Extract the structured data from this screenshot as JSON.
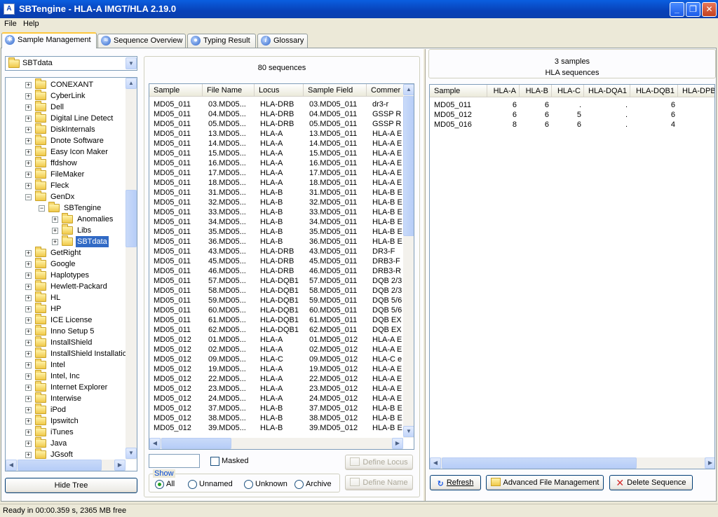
{
  "window": {
    "title": "SBTengine - HLA-A IMGT/HLA 2.19.0",
    "app_icon": "A"
  },
  "menu": [
    {
      "label": "File"
    },
    {
      "label": "Help"
    }
  ],
  "tabs": [
    {
      "label": "Sample Management",
      "icon": "gear-icon",
      "active": true
    },
    {
      "label": "Sequence Overview",
      "icon": "chart-icon",
      "active": false
    },
    {
      "label": "Typing Result",
      "icon": "result-icon",
      "active": false
    },
    {
      "label": "Glossary",
      "icon": "info-icon",
      "active": false
    }
  ],
  "sample_management": {
    "folder_dropdown": {
      "value": "SBTdata"
    },
    "tree": [
      {
        "label": "CONEXANT",
        "level": 1
      },
      {
        "label": "CyberLink",
        "level": 1
      },
      {
        "label": "Dell",
        "level": 1
      },
      {
        "label": "Digital Line Detect",
        "level": 1
      },
      {
        "label": "DiskInternals",
        "level": 1
      },
      {
        "label": "Dnote Software",
        "level": 1
      },
      {
        "label": "Easy Icon Maker",
        "level": 1
      },
      {
        "label": "ffdshow",
        "level": 1
      },
      {
        "label": "FileMaker",
        "level": 1
      },
      {
        "label": "Fleck",
        "level": 1
      },
      {
        "label": "GenDx",
        "level": 1,
        "expanded": true
      },
      {
        "label": "SBTengine",
        "level": 2,
        "expanded": true
      },
      {
        "label": "Anomalies",
        "level": 3
      },
      {
        "label": "Libs",
        "level": 3
      },
      {
        "label": "SBTdata",
        "level": 3,
        "selected": true
      },
      {
        "label": "GetRight",
        "level": 1
      },
      {
        "label": "Google",
        "level": 1
      },
      {
        "label": "Haplotypes",
        "level": 1
      },
      {
        "label": "Hewlett-Packard",
        "level": 1
      },
      {
        "label": "HL",
        "level": 1
      },
      {
        "label": "HP",
        "level": 1
      },
      {
        "label": "ICE License",
        "level": 1
      },
      {
        "label": "Inno Setup 5",
        "level": 1
      },
      {
        "label": "InstallShield",
        "level": 1
      },
      {
        "label": "InstallShield Installatio",
        "level": 1
      },
      {
        "label": "Intel",
        "level": 1
      },
      {
        "label": "Intel, Inc",
        "level": 1
      },
      {
        "label": "Internet Explorer",
        "level": 1
      },
      {
        "label": "Interwise",
        "level": 1
      },
      {
        "label": "iPod",
        "level": 1
      },
      {
        "label": "Ipswitch",
        "level": 1
      },
      {
        "label": "iTunes",
        "level": 1
      },
      {
        "label": "Java",
        "level": 1
      },
      {
        "label": "JGsoft",
        "level": 1
      }
    ],
    "hide_tree_label": "Hide Tree",
    "sequences": {
      "count_label": "80 sequences",
      "columns": [
        "Sample",
        "File Name",
        "Locus",
        "Sample Field",
        "Commer"
      ],
      "rows": [
        [
          "MD05_011",
          "03.MD05...",
          "HLA-DRB",
          "03.MD05_011",
          "dr3-r"
        ],
        [
          "MD05_011",
          "04.MD05...",
          "HLA-DRB",
          "04.MD05_011",
          "GSSP R"
        ],
        [
          "MD05_011",
          "05.MD05...",
          "HLA-DRB",
          "05.MD05_011",
          "GSSP R"
        ],
        [
          "MD05_011",
          "13.MD05...",
          "HLA-A",
          "13.MD05_011",
          "HLA-A E"
        ],
        [
          "MD05_011",
          "14.MD05...",
          "HLA-A",
          "14.MD05_011",
          "HLA-A E"
        ],
        [
          "MD05_011",
          "15.MD05...",
          "HLA-A",
          "15.MD05_011",
          "HLA-A E"
        ],
        [
          "MD05_011",
          "16.MD05...",
          "HLA-A",
          "16.MD05_011",
          "HLA-A E"
        ],
        [
          "MD05_011",
          "17.MD05...",
          "HLA-A",
          "17.MD05_011",
          "HLA-A E"
        ],
        [
          "MD05_011",
          "18.MD05...",
          "HLA-A",
          "18.MD05_011",
          "HLA-A E"
        ],
        [
          "MD05_011",
          "31.MD05...",
          "HLA-B",
          "31.MD05_011",
          "HLA-B E"
        ],
        [
          "MD05_011",
          "32.MD05...",
          "HLA-B",
          "32.MD05_011",
          "HLA-B E"
        ],
        [
          "MD05_011",
          "33.MD05...",
          "HLA-B",
          "33.MD05_011",
          "HLA-B E"
        ],
        [
          "MD05_011",
          "34.MD05...",
          "HLA-B",
          "34.MD05_011",
          "HLA-B E"
        ],
        [
          "MD05_011",
          "35.MD05...",
          "HLA-B",
          "35.MD05_011",
          "HLA-B E"
        ],
        [
          "MD05_011",
          "36.MD05...",
          "HLA-B",
          "36.MD05_011",
          "HLA-B E"
        ],
        [
          "MD05_011",
          "43.MD05...",
          "HLA-DRB",
          "43.MD05_011",
          "DR3-F"
        ],
        [
          "MD05_011",
          "45.MD05...",
          "HLA-DRB",
          "45.MD05_011",
          "DRB3-F"
        ],
        [
          "MD05_011",
          "46.MD05...",
          "HLA-DRB",
          "46.MD05_011",
          "DRB3-R"
        ],
        [
          "MD05_011",
          "57.MD05...",
          "HLA-DQB1",
          "57.MD05_011",
          "DQB 2/3"
        ],
        [
          "MD05_011",
          "58.MD05...",
          "HLA-DQB1",
          "58.MD05_011",
          "DQB 2/3"
        ],
        [
          "MD05_011",
          "59.MD05...",
          "HLA-DQB1",
          "59.MD05_011",
          "DQB 5/6"
        ],
        [
          "MD05_011",
          "60.MD05...",
          "HLA-DQB1",
          "60.MD05_011",
          "DQB 5/6"
        ],
        [
          "MD05_011",
          "61.MD05...",
          "HLA-DQB1",
          "61.MD05_011",
          "DQB EX"
        ],
        [
          "MD05_011",
          "62.MD05...",
          "HLA-DQB1",
          "62.MD05_011",
          "DQB EX"
        ],
        [
          "MD05_012",
          "01.MD05...",
          "HLA-A",
          "01.MD05_012",
          "HLA-A E"
        ],
        [
          "MD05_012",
          "02.MD05...",
          "HLA-A",
          "02.MD05_012",
          "HLA-A E"
        ],
        [
          "MD05_012",
          "09.MD05...",
          "HLA-C",
          "09.MD05_012",
          "HLA-C e"
        ],
        [
          "MD05_012",
          "19.MD05...",
          "HLA-A",
          "19.MD05_012",
          "HLA-A E"
        ],
        [
          "MD05_012",
          "22.MD05...",
          "HLA-A",
          "22.MD05_012",
          "HLA-A E"
        ],
        [
          "MD05_012",
          "23.MD05...",
          "HLA-A",
          "23.MD05_012",
          "HLA-A E"
        ],
        [
          "MD05_012",
          "24.MD05...",
          "HLA-A",
          "24.MD05_012",
          "HLA-A E"
        ],
        [
          "MD05_012",
          "37.MD05...",
          "HLA-B",
          "37.MD05_012",
          "HLA-B E"
        ],
        [
          "MD05_012",
          "38.MD05...",
          "HLA-B",
          "38.MD05_012",
          "HLA-B E"
        ],
        [
          "MD05_012",
          "39.MD05...",
          "HLA-B",
          "39.MD05_012",
          "HLA-B E"
        ]
      ],
      "search_value": "",
      "masked_label": "Masked",
      "define_locus_label": "Define Locus",
      "define_name_label": "Define Name",
      "show": {
        "legend": "Show",
        "options": [
          {
            "label": "All",
            "selected": true
          },
          {
            "label": "Unnamed",
            "selected": false
          },
          {
            "label": "Unknown",
            "selected": false
          },
          {
            "label": "Archive",
            "selected": false
          }
        ]
      }
    },
    "samples": {
      "count_label": "3 samples",
      "subtitle": "HLA sequences",
      "columns": [
        "Sample",
        "HLA-A",
        "HLA-B",
        "HLA-C",
        "HLA-DQA1",
        "HLA-DQB1",
        "HLA-DPB"
      ],
      "rows": [
        [
          "MD05_011",
          "6",
          "6",
          ".",
          ".",
          "6",
          ""
        ],
        [
          "MD05_012",
          "6",
          "6",
          "5",
          ".",
          "6",
          ""
        ],
        [
          "MD05_016",
          "8",
          "6",
          "6",
          ".",
          "4",
          ""
        ]
      ],
      "refresh_label": "Refresh",
      "advanced_label": "Advanced File Management",
      "delete_label": "Delete Sequence"
    }
  },
  "status": {
    "text": "Ready in 00:00.359 s, 2365 MB free"
  },
  "colors": {
    "selection": "#316ac5",
    "titlebar": "#0841b8",
    "delete_x": "#d42a2a"
  }
}
